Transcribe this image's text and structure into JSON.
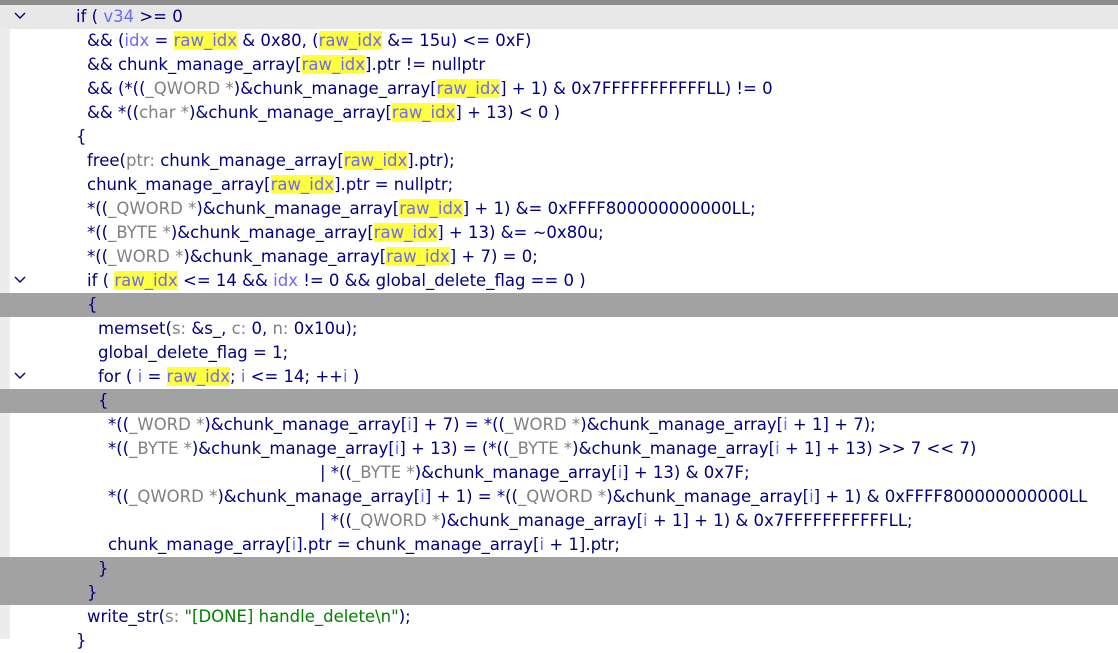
{
  "editor": {
    "colors": {
      "text": "#000080",
      "local_var": "#6a6aff",
      "type": "#808080",
      "string": "#008000",
      "highlight": "#ffff3c",
      "current_line": "#e8e8e8",
      "selected_block": "#a2a2a2"
    },
    "fold_icon": "chevron-down-icon",
    "lines": [
      {
        "indent": 76,
        "fold": true,
        "hl": "light",
        "tokens": [
          {
            "t": "if ( ",
            "c": "kw"
          },
          {
            "t": "v34",
            "c": "loc"
          },
          {
            "t": " >= 0",
            "c": "lit"
          }
        ]
      },
      {
        "indent": 87,
        "tokens": [
          {
            "t": "&& (",
            "c": "sym"
          },
          {
            "t": "idx",
            "c": "loc"
          },
          {
            "t": " = ",
            "c": "sym"
          },
          {
            "t": "raw_idx",
            "c": "idx"
          },
          {
            "t": " & 0x80, (",
            "c": "lit"
          },
          {
            "t": "raw_idx",
            "c": "idx"
          },
          {
            "t": " &= 15u) <= 0xF)",
            "c": "lit"
          }
        ]
      },
      {
        "indent": 87,
        "tokens": [
          {
            "t": "&& chunk_manage_array[",
            "c": "gv"
          },
          {
            "t": "raw_idx",
            "c": "idx"
          },
          {
            "t": "].ptr != nullptr",
            "c": "gv"
          }
        ]
      },
      {
        "indent": 87,
        "tokens": [
          {
            "t": "&& (*((",
            "c": "sym"
          },
          {
            "t": "_QWORD *",
            "c": "typ"
          },
          {
            "t": ")&chunk_manage_array[",
            "c": "gv"
          },
          {
            "t": "raw_idx",
            "c": "idx"
          },
          {
            "t": "] + 1) & 0x7FFFFFFFFFFFLL) != 0",
            "c": "lit"
          }
        ]
      },
      {
        "indent": 87,
        "tokens": [
          {
            "t": "&& *((",
            "c": "sym"
          },
          {
            "t": "char *",
            "c": "typ"
          },
          {
            "t": ")&chunk_manage_array[",
            "c": "gv"
          },
          {
            "t": "raw_idx",
            "c": "idx"
          },
          {
            "t": "] + 13) < 0 )",
            "c": "lit"
          }
        ]
      },
      {
        "indent": 76,
        "tokens": [
          {
            "t": "{",
            "c": "sym"
          }
        ]
      },
      {
        "indent": 87,
        "tokens": [
          {
            "t": "free(",
            "c": "fn"
          },
          {
            "t": "ptr: ",
            "c": "prm"
          },
          {
            "t": "chunk_manage_array[",
            "c": "gv"
          },
          {
            "t": "raw_idx",
            "c": "idx"
          },
          {
            "t": "].ptr);",
            "c": "gv"
          }
        ]
      },
      {
        "indent": 87,
        "tokens": [
          {
            "t": "chunk_manage_array[",
            "c": "gv"
          },
          {
            "t": "raw_idx",
            "c": "idx"
          },
          {
            "t": "].ptr = nullptr;",
            "c": "gv"
          }
        ]
      },
      {
        "indent": 87,
        "tokens": [
          {
            "t": "*((",
            "c": "sym"
          },
          {
            "t": "_QWORD *",
            "c": "typ"
          },
          {
            "t": ")&chunk_manage_array[",
            "c": "gv"
          },
          {
            "t": "raw_idx",
            "c": "idx"
          },
          {
            "t": "] + 1) &= 0xFFFF800000000000LL;",
            "c": "lit"
          }
        ]
      },
      {
        "indent": 87,
        "tokens": [
          {
            "t": "*((",
            "c": "sym"
          },
          {
            "t": "_BYTE *",
            "c": "typ"
          },
          {
            "t": ")&chunk_manage_array[",
            "c": "gv"
          },
          {
            "t": "raw_idx",
            "c": "idx"
          },
          {
            "t": "] + 13) &= ~0x80u;",
            "c": "lit"
          }
        ]
      },
      {
        "indent": 87,
        "tokens": [
          {
            "t": "*((",
            "c": "sym"
          },
          {
            "t": "_WORD *",
            "c": "typ"
          },
          {
            "t": ")&chunk_manage_array[",
            "c": "gv"
          },
          {
            "t": "raw_idx",
            "c": "idx"
          },
          {
            "t": "] + 7) = 0;",
            "c": "lit"
          }
        ]
      },
      {
        "indent": 87,
        "fold": true,
        "tokens": [
          {
            "t": "if ( ",
            "c": "kw"
          },
          {
            "t": "raw_idx",
            "c": "idx"
          },
          {
            "t": " <= 14 && ",
            "c": "lit"
          },
          {
            "t": "idx",
            "c": "loc"
          },
          {
            "t": " != 0 && global_delete_flag == 0 )",
            "c": "gv"
          }
        ]
      },
      {
        "indent": 87,
        "hl": "dark",
        "tokens": [
          {
            "t": "{",
            "c": "sym"
          }
        ]
      },
      {
        "indent": 98,
        "tokens": [
          {
            "t": "memset(",
            "c": "fn"
          },
          {
            "t": "s: ",
            "c": "prm"
          },
          {
            "t": "&s_, ",
            "c": "gv"
          },
          {
            "t": "c: ",
            "c": "prm"
          },
          {
            "t": "0, ",
            "c": "lit"
          },
          {
            "t": "n: ",
            "c": "prm"
          },
          {
            "t": "0x10u);",
            "c": "lit"
          }
        ]
      },
      {
        "indent": 98,
        "tokens": [
          {
            "t": "global_delete_flag = 1;",
            "c": "gv"
          }
        ]
      },
      {
        "indent": 98,
        "fold": true,
        "tokens": [
          {
            "t": "for ( ",
            "c": "kw"
          },
          {
            "t": "i",
            "c": "loc"
          },
          {
            "t": " = ",
            "c": "sym"
          },
          {
            "t": "raw_idx",
            "c": "idx"
          },
          {
            "t": "; ",
            "c": "sym"
          },
          {
            "t": "i",
            "c": "loc"
          },
          {
            "t": " <= 14; ++",
            "c": "lit"
          },
          {
            "t": "i",
            "c": "loc"
          },
          {
            "t": " )",
            "c": "sym"
          }
        ]
      },
      {
        "indent": 98,
        "hl": "dark",
        "tokens": [
          {
            "t": "{",
            "c": "sym"
          }
        ]
      },
      {
        "indent": 108,
        "tokens": [
          {
            "t": "*((",
            "c": "sym"
          },
          {
            "t": "_WORD *",
            "c": "typ"
          },
          {
            "t": ")&chunk_manage_array[",
            "c": "gv"
          },
          {
            "t": "i",
            "c": "loc"
          },
          {
            "t": "] + 7) = *((",
            "c": "lit"
          },
          {
            "t": "_WORD *",
            "c": "typ"
          },
          {
            "t": ")&chunk_manage_array[",
            "c": "gv"
          },
          {
            "t": "i",
            "c": "loc"
          },
          {
            "t": " + 1] + 7);",
            "c": "lit"
          }
        ]
      },
      {
        "indent": 108,
        "tokens": [
          {
            "t": "*((",
            "c": "sym"
          },
          {
            "t": "_BYTE *",
            "c": "typ"
          },
          {
            "t": ")&chunk_manage_array[",
            "c": "gv"
          },
          {
            "t": "i",
            "c": "loc"
          },
          {
            "t": "] + 13) = (*((",
            "c": "lit"
          },
          {
            "t": "_BYTE *",
            "c": "typ"
          },
          {
            "t": ")&chunk_manage_array[",
            "c": "gv"
          },
          {
            "t": "i",
            "c": "loc"
          },
          {
            "t": " + 1] + 13) >> 7 << 7)",
            "c": "lit"
          }
        ]
      },
      {
        "indent": 320,
        "tokens": [
          {
            "t": "| *((",
            "c": "sym"
          },
          {
            "t": "_BYTE *",
            "c": "typ"
          },
          {
            "t": ")&chunk_manage_array[",
            "c": "gv"
          },
          {
            "t": "i",
            "c": "loc"
          },
          {
            "t": "] + 13) & 0x7F;",
            "c": "lit"
          }
        ]
      },
      {
        "indent": 108,
        "tokens": [
          {
            "t": "*((",
            "c": "sym"
          },
          {
            "t": "_QWORD *",
            "c": "typ"
          },
          {
            "t": ")&chunk_manage_array[",
            "c": "gv"
          },
          {
            "t": "i",
            "c": "loc"
          },
          {
            "t": "] + 1) = *((",
            "c": "lit"
          },
          {
            "t": "_QWORD *",
            "c": "typ"
          },
          {
            "t": ")&chunk_manage_array[",
            "c": "gv"
          },
          {
            "t": "i",
            "c": "loc"
          },
          {
            "t": "] + 1) & 0xFFFF800000000000LL",
            "c": "lit"
          }
        ]
      },
      {
        "indent": 320,
        "tokens": [
          {
            "t": "| *((",
            "c": "sym"
          },
          {
            "t": "_QWORD *",
            "c": "typ"
          },
          {
            "t": ")&chunk_manage_array[",
            "c": "gv"
          },
          {
            "t": "i",
            "c": "loc"
          },
          {
            "t": " + 1] + 1) & 0x7FFFFFFFFFFFLL;",
            "c": "lit"
          }
        ]
      },
      {
        "indent": 108,
        "tokens": [
          {
            "t": "chunk_manage_array[",
            "c": "gv"
          },
          {
            "t": "i",
            "c": "loc"
          },
          {
            "t": "].ptr = chunk_manage_array[",
            "c": "gv"
          },
          {
            "t": "i",
            "c": "loc"
          },
          {
            "t": " + 1].ptr;",
            "c": "gv"
          }
        ]
      },
      {
        "indent": 98,
        "hl": "dark",
        "tokens": [
          {
            "t": "}",
            "c": "sym"
          }
        ]
      },
      {
        "indent": 87,
        "hl": "dark",
        "tokens": [
          {
            "t": "}",
            "c": "sym"
          }
        ]
      },
      {
        "indent": 87,
        "tokens": [
          {
            "t": "write_str(",
            "c": "fn"
          },
          {
            "t": "s: ",
            "c": "prm"
          },
          {
            "t": "\"[DONE] handle_delete\\n\"",
            "c": "str"
          },
          {
            "t": ");",
            "c": "sym"
          }
        ]
      },
      {
        "indent": 76,
        "tokens": [
          {
            "t": "}",
            "c": "sym"
          }
        ]
      }
    ]
  }
}
